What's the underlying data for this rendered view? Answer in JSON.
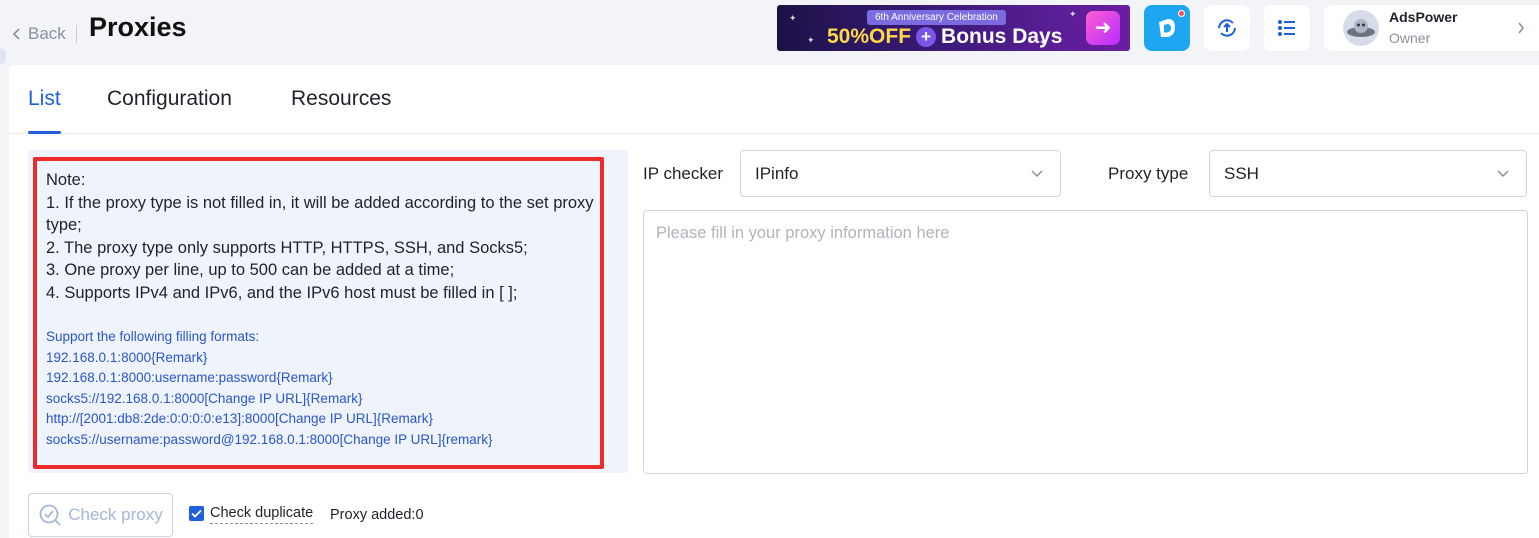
{
  "header": {
    "back_label": "Back",
    "title": "Proxies"
  },
  "promo": {
    "subtitle": "6th Anniversary Celebration",
    "discount": "50%OFF",
    "main": "Bonus Days"
  },
  "icons": {
    "app": "app-logo-icon",
    "sync": "sync-upload-icon",
    "tasks": "task-list-icon"
  },
  "user": {
    "name": "AdsPower",
    "role": "Owner"
  },
  "tabs": [
    {
      "label": "List",
      "active": true
    },
    {
      "label": "Configuration",
      "active": false
    },
    {
      "label": "Resources",
      "active": false
    }
  ],
  "note": {
    "lines": [
      "Note:",
      "1. If the proxy type is not filled in, it will be added according to the set proxy type;",
      "2. The proxy type only supports HTTP, HTTPS, SSH, and Socks5;",
      "3. One proxy per line, up to 500 can be added at a time;",
      "4. Supports IPv4 and IPv6, and the IPv6 host must be filled in [ ];"
    ],
    "formats_title": "Support the following filling formats:",
    "formats": [
      "192.168.0.1:8000{Remark}",
      "192.168.0.1:8000:username:password{Remark}",
      "socks5://192.168.0.1:8000[Change IP URL]{Remark}",
      "http://[2001:db8:2de:0:0:0:0:e13]:8000[Change IP URL]{Remark}",
      "socks5://username:password@192.168.0.1:8000[Change IP URL]{remark}"
    ]
  },
  "form": {
    "ip_checker_label": "IP checker",
    "ip_checker_value": "IPinfo",
    "proxy_type_label": "Proxy type",
    "proxy_type_value": "SSH",
    "textarea_placeholder": "Please fill in your proxy information here"
  },
  "footer": {
    "check_proxy_label": "Check proxy",
    "check_duplicate_label": "Check duplicate",
    "check_duplicate_checked": true,
    "proxy_added": "Proxy added:0"
  },
  "colors": {
    "accent": "#1f5fdd",
    "highlight": "#ee2a2a",
    "format_text": "#2a56c9"
  }
}
